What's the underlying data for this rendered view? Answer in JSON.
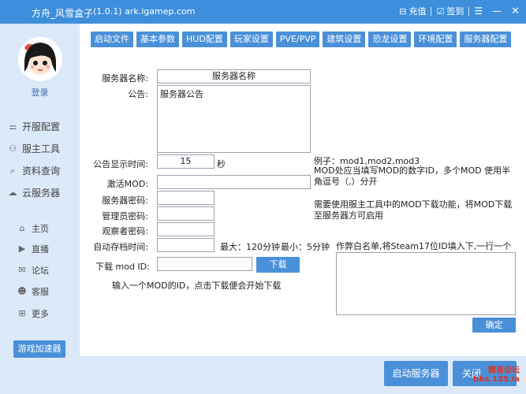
{
  "titlebar": {
    "title": "方舟_风雪盒子",
    "version": "(1.0.1) ark.igamep.com",
    "recharge": "充值",
    "signin": "签到"
  },
  "sidebar": {
    "login": "登录",
    "main_items": [
      "开服配置",
      "服主工具",
      "资料查询",
      "云服务器"
    ],
    "sub_items": [
      "主页",
      "直播",
      "论坛",
      "客服",
      "更多"
    ],
    "accelerator": "游戏加速器"
  },
  "tabs": [
    "启动文件",
    "基本参数",
    "HUD配置",
    "玩家设置",
    "PVE/PVP",
    "建筑设置",
    "恐龙设置",
    "环境配置",
    "服务器配置"
  ],
  "form": {
    "server_name_label": "服务器名称:",
    "server_name_value": "服务器名称",
    "announcement_label": "公告:",
    "announcement_value": "服务器公告",
    "announce_time_label": "公告显示时间:",
    "announce_time_value": "15",
    "announce_time_unit": "秒",
    "activate_mod_label": "激活MOD:",
    "server_password_label": "服务器密码:",
    "admin_password_label": "管理员密码:",
    "spectator_password_label": "观察者密码:",
    "autosave_label": "自动存档时间:",
    "autosave_max": "最大：120分钟",
    "autosave_min": "最小：5分钟",
    "download_mod_label": "下载 mod ID:",
    "download_button": "下载",
    "download_hint": "输入一个MOD的ID，点击下载便会开始下载"
  },
  "hints": {
    "example": "例子：mod1,mod2,mod3",
    "mod_explain": "MOD处应当填写MOD的数字ID，多个MOD 使用半角逗号（,）分开",
    "tool_hint": "需要使用服主工具中的MOD下载功能，将MOD下载至服务器方可启用",
    "whitelist_hint": "作弊白名单,将Steam17位ID填入下,一行一个",
    "confirm_button": "确定"
  },
  "footer": {
    "start_button": "启动服务器",
    "close_button": "关闭",
    "watermark_title": "精易论坛",
    "watermark_url": "bbs.125.la"
  }
}
